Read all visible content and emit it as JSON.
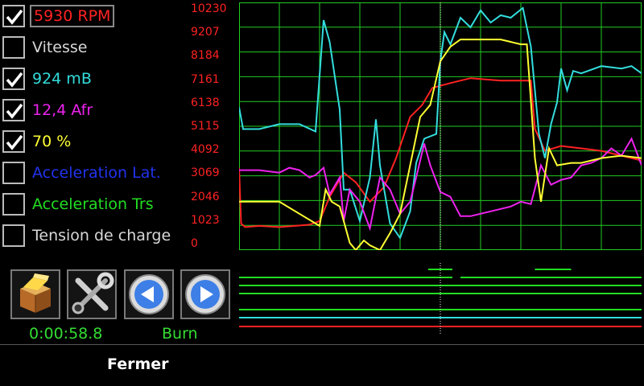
{
  "channels": [
    {
      "label": "5930 RPM",
      "checked": true,
      "color": "#ff2222",
      "boxed": true
    },
    {
      "label": "Vitesse",
      "checked": false,
      "color": "#d8d8d8",
      "boxed": false
    },
    {
      "label": "924 mB",
      "checked": true,
      "color": "#33dddd",
      "boxed": false
    },
    {
      "label": "12,4 Afr",
      "checked": true,
      "color": "#ee22ee",
      "boxed": false
    },
    {
      "label": "70 %",
      "checked": true,
      "color": "#ffff33",
      "boxed": false
    },
    {
      "label": "Acceleration Lat.",
      "checked": false,
      "color": "#2233ee",
      "boxed": false
    },
    {
      "label": "Acceleration Trs",
      "checked": false,
      "color": "#22dd22",
      "boxed": false
    },
    {
      "label": "Tension de charge",
      "checked": false,
      "color": "#d8d8d8",
      "boxed": false
    }
  ],
  "y_axis": {
    "ticks": [
      "10230",
      "9207",
      "8184",
      "7161",
      "6138",
      "5115",
      "4092",
      "3069",
      "2046",
      "1023",
      "0"
    ],
    "color": "#ff2222"
  },
  "chart_data": {
    "type": "line",
    "ylim": [
      0,
      10230
    ],
    "grid": true,
    "cursor_fraction": 0.5,
    "series": [
      {
        "color": "#ff2222",
        "points": [
          [
            0,
            3400
          ],
          [
            0.01,
            1100
          ],
          [
            0.03,
            950
          ],
          [
            0.1,
            1000
          ],
          [
            0.2,
            950
          ],
          [
            0.35,
            1050
          ],
          [
            0.4,
            1200
          ],
          [
            0.45,
            2200
          ],
          [
            0.52,
            3200
          ],
          [
            0.58,
            2800
          ],
          [
            0.65,
            2000
          ],
          [
            0.72,
            2600
          ],
          [
            0.78,
            3800
          ],
          [
            0.85,
            5500
          ],
          [
            0.91,
            6000
          ],
          [
            0.96,
            6700
          ],
          [
            1.05,
            6900
          ],
          [
            1.15,
            7100
          ],
          [
            1.3,
            7000
          ],
          [
            1.45,
            7000
          ],
          [
            1.47,
            5000
          ],
          [
            1.52,
            4100
          ],
          [
            1.6,
            4300
          ],
          [
            1.7,
            4200
          ],
          [
            1.8,
            4100
          ],
          [
            1.9,
            3900
          ],
          [
            2.0,
            3700
          ]
        ]
      },
      {
        "color": "#33dddd",
        "points": [
          [
            0,
            5900
          ],
          [
            0.02,
            5000
          ],
          [
            0.1,
            5000
          ],
          [
            0.2,
            5200
          ],
          [
            0.3,
            5200
          ],
          [
            0.38,
            4900
          ],
          [
            0.42,
            9500
          ],
          [
            0.45,
            8600
          ],
          [
            0.5,
            5800
          ],
          [
            0.52,
            2500
          ],
          [
            0.55,
            2500
          ],
          [
            0.6,
            1200
          ],
          [
            0.65,
            3000
          ],
          [
            0.68,
            5400
          ],
          [
            0.7,
            3500
          ],
          [
            0.75,
            1100
          ],
          [
            0.8,
            500
          ],
          [
            0.85,
            1600
          ],
          [
            0.88,
            3600
          ],
          [
            0.92,
            4600
          ],
          [
            0.98,
            4800
          ],
          [
            1.0,
            7800
          ],
          [
            1.02,
            9000
          ],
          [
            1.05,
            8500
          ],
          [
            1.1,
            9600
          ],
          [
            1.15,
            9200
          ],
          [
            1.2,
            9900
          ],
          [
            1.25,
            9400
          ],
          [
            1.3,
            9700
          ],
          [
            1.35,
            9600
          ],
          [
            1.41,
            10000
          ],
          [
            1.45,
            8400
          ],
          [
            1.49,
            4800
          ],
          [
            1.52,
            3800
          ],
          [
            1.55,
            5200
          ],
          [
            1.58,
            6100
          ],
          [
            1.6,
            7500
          ],
          [
            1.63,
            6600
          ],
          [
            1.66,
            7400
          ],
          [
            1.7,
            7300
          ],
          [
            1.8,
            7600
          ],
          [
            1.9,
            7500
          ],
          [
            1.95,
            7600
          ],
          [
            2.0,
            7300
          ]
        ]
      },
      {
        "color": "#ee22ee",
        "points": [
          [
            0,
            3300
          ],
          [
            0.1,
            3300
          ],
          [
            0.2,
            3200
          ],
          [
            0.25,
            3400
          ],
          [
            0.3,
            3300
          ],
          [
            0.35,
            3000
          ],
          [
            0.38,
            3100
          ],
          [
            0.42,
            3400
          ],
          [
            0.45,
            2300
          ],
          [
            0.5,
            3000
          ],
          [
            0.52,
            1200
          ],
          [
            0.55,
            2500
          ],
          [
            0.6,
            2000
          ],
          [
            0.65,
            900
          ],
          [
            0.7,
            3000
          ],
          [
            0.75,
            2500
          ],
          [
            0.8,
            1500
          ],
          [
            0.85,
            2000
          ],
          [
            0.88,
            3000
          ],
          [
            0.92,
            4400
          ],
          [
            0.95,
            3500
          ],
          [
            1.0,
            2400
          ],
          [
            1.05,
            2200
          ],
          [
            1.1,
            1400
          ],
          [
            1.15,
            1400
          ],
          [
            1.2,
            1500
          ],
          [
            1.25,
            1600
          ],
          [
            1.35,
            1800
          ],
          [
            1.4,
            2000
          ],
          [
            1.45,
            1900
          ],
          [
            1.5,
            3500
          ],
          [
            1.55,
            2700
          ],
          [
            1.6,
            2900
          ],
          [
            1.65,
            3000
          ],
          [
            1.7,
            3500
          ],
          [
            1.75,
            3600
          ],
          [
            1.8,
            3800
          ],
          [
            1.85,
            4200
          ],
          [
            1.9,
            3900
          ],
          [
            1.95,
            4600
          ],
          [
            2.0,
            3500
          ]
        ]
      },
      {
        "color": "#ffff33",
        "points": [
          [
            0,
            2000
          ],
          [
            0.1,
            2000
          ],
          [
            0.2,
            2000
          ],
          [
            0.4,
            1000
          ],
          [
            0.43,
            2500
          ],
          [
            0.46,
            2000
          ],
          [
            0.5,
            1800
          ],
          [
            0.55,
            300
          ],
          [
            0.58,
            0
          ],
          [
            0.62,
            400
          ],
          [
            0.65,
            200
          ],
          [
            0.7,
            0
          ],
          [
            0.75,
            700
          ],
          [
            0.8,
            1500
          ],
          [
            0.85,
            3500
          ],
          [
            0.9,
            5500
          ],
          [
            0.95,
            6000
          ],
          [
            1.0,
            7800
          ],
          [
            1.05,
            8400
          ],
          [
            1.1,
            8700
          ],
          [
            1.2,
            8700
          ],
          [
            1.3,
            8700
          ],
          [
            1.4,
            8500
          ],
          [
            1.43,
            8500
          ],
          [
            1.47,
            3800
          ],
          [
            1.5,
            2000
          ],
          [
            1.54,
            4200
          ],
          [
            1.58,
            3500
          ],
          [
            1.65,
            3600
          ],
          [
            1.7,
            3600
          ],
          [
            1.8,
            3800
          ],
          [
            1.9,
            3900
          ],
          [
            2.0,
            3800
          ]
        ]
      }
    ]
  },
  "mini_tracks": [
    {
      "color": "#22dd22",
      "segments": [
        [
          0.47,
          0.53
        ],
        [
          0.735,
          0.825
        ]
      ]
    },
    {
      "color": "#22dd22",
      "segments": [
        [
          0,
          0.5
        ],
        [
          0.5,
          0.53
        ],
        [
          0.55,
          1.0
        ]
      ]
    },
    {
      "color": "#22dd22",
      "segments": [
        [
          0,
          1.0
        ]
      ]
    },
    {
      "color": "#22dd22",
      "segments": [
        [
          0,
          1.0
        ]
      ]
    },
    {
      "color": "#22dd22",
      "segments": [
        [
          0,
          1.0
        ]
      ]
    },
    {
      "color": "#33dddd",
      "segments": [
        [
          0,
          1.0
        ]
      ]
    },
    {
      "color": "#ff2222",
      "segments": [
        [
          0,
          1.0
        ]
      ]
    }
  ],
  "toolbar": {
    "buttons": [
      {
        "name": "package-icon"
      },
      {
        "name": "tools-icon"
      },
      {
        "name": "previous-icon"
      },
      {
        "name": "next-icon"
      }
    ]
  },
  "status": {
    "time": "0:00:58.8",
    "mode": "Burn"
  },
  "footer": {
    "close_label": "Fermer"
  }
}
